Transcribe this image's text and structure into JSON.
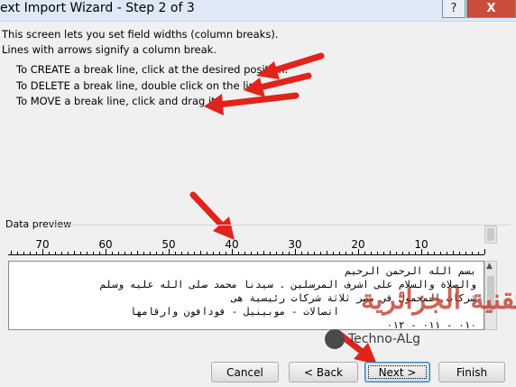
{
  "window": {
    "title": "ext Import Wizard - Step 2 of 3",
    "help_label": "?",
    "close_label": "X"
  },
  "description": [
    "This screen lets you set field widths (column breaks).",
    "Lines with arrows signify a column break."
  ],
  "instructions": [
    "To CREATE a break line, click at the desired position.",
    "To DELETE a break line, double click on the line.",
    "To MOVE a break line, click and drag it."
  ],
  "data_preview": {
    "label": "Data preview",
    "ruler_labels": [
      "70",
      "60",
      "50",
      "40",
      "30",
      "20",
      "10"
    ],
    "lines": [
      "بسم الله الرحمن الرحيم",
      "والصلاة والسلام على اشرف المرسلين . سيدنا محمد صلى الله عليه وسلم",
      "شركات المحمول في مصر ثلاثة شركات رئيسية هى",
      "اتصالات - موبينيل - فودافون وارقامها",
      "٠١٠ - ٠١١ - ٠١٢"
    ]
  },
  "watermark": {
    "text": "التقنية الجزائرية",
    "logo_text": "Techno-ALg"
  },
  "buttons": {
    "cancel": "Cancel",
    "back": "< Back",
    "next": "Next >",
    "finish": "Finish"
  },
  "colors": {
    "arrow": "#e0241b",
    "close_button": "#c94c3c",
    "watermark": "#c0392b"
  }
}
